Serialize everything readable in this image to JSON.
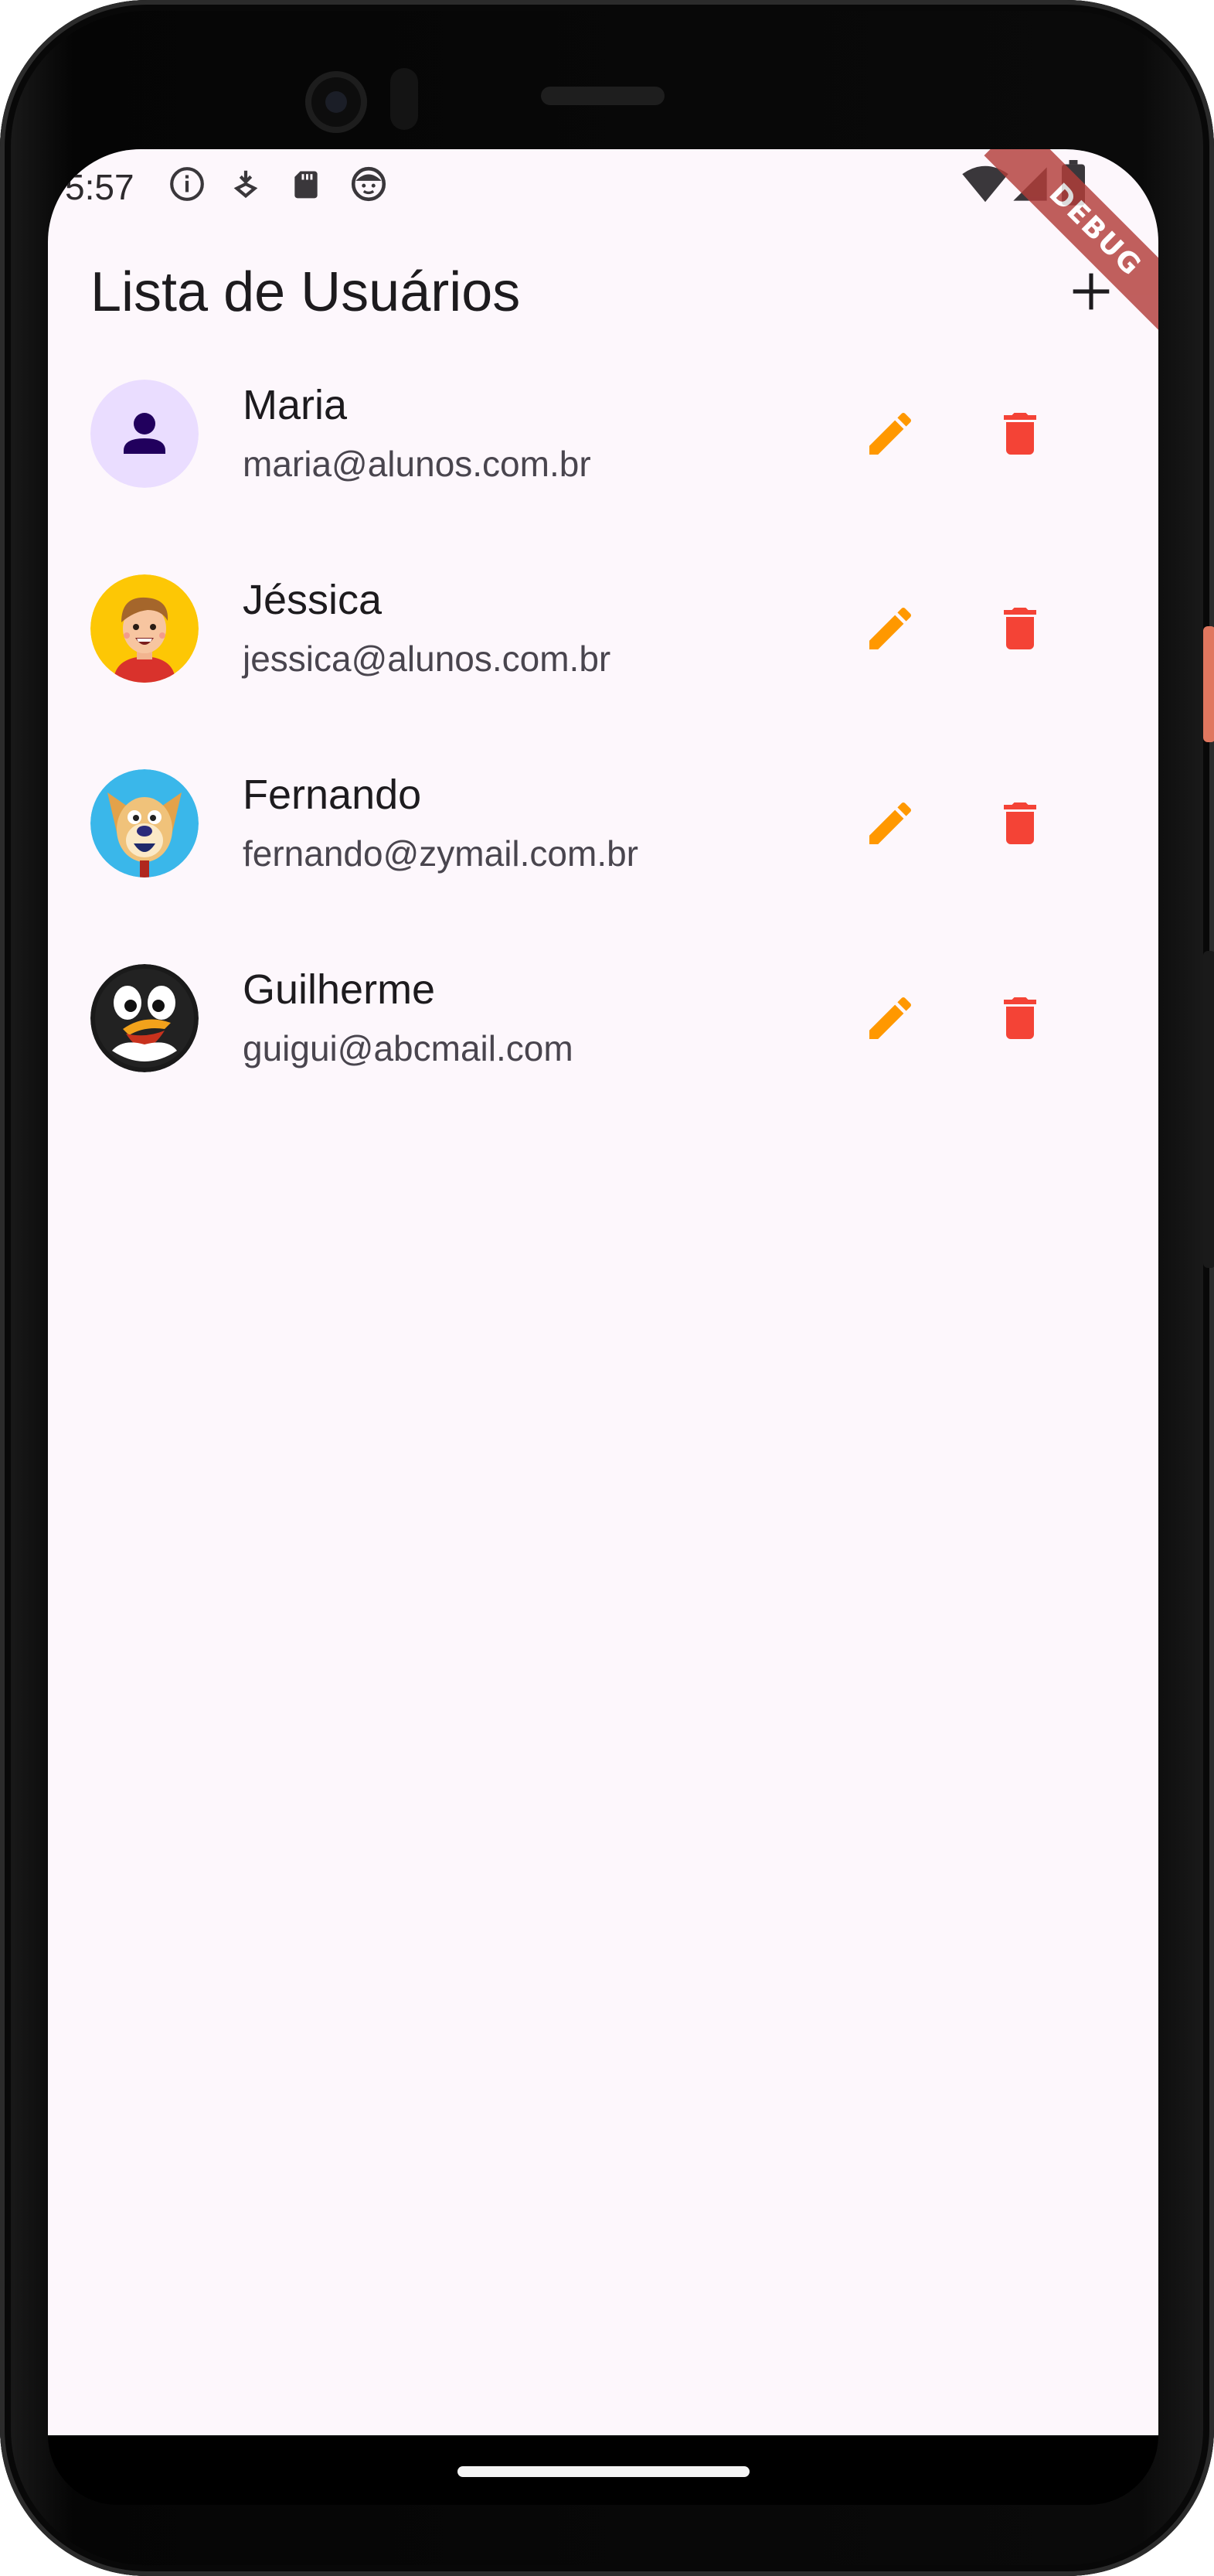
{
  "status_bar": {
    "time": "5:57",
    "left_icons": [
      "info-icon",
      "location-icon",
      "sd-card-icon",
      "face-icon"
    ],
    "right_icons": [
      "wifi-icon",
      "signal-icon",
      "battery-icon"
    ]
  },
  "debug_banner": "DEBUG",
  "app_bar": {
    "title": "Lista de Usuários",
    "add_icon": "add-icon"
  },
  "users": [
    {
      "name": "Maria",
      "email": "maria@alunos.com.br",
      "avatar": "default-person"
    },
    {
      "name": "Jéssica",
      "email": "jessica@alunos.com.br",
      "avatar": "cartoon-boy"
    },
    {
      "name": "Fernando",
      "email": "fernando@zymail.com.br",
      "avatar": "cartoon-dog"
    },
    {
      "name": "Guilherme",
      "email": "guigui@abcmail.com",
      "avatar": "cartoon-penguin"
    }
  ],
  "actions": {
    "edit_icon": "pencil-icon",
    "delete_icon": "trash-icon"
  },
  "colors": {
    "background": "#fdf7fc",
    "edit": "#ff9800",
    "delete": "#f44336",
    "avatar_default_bg": "#eaddff",
    "avatar_default_fg": "#21005d"
  }
}
